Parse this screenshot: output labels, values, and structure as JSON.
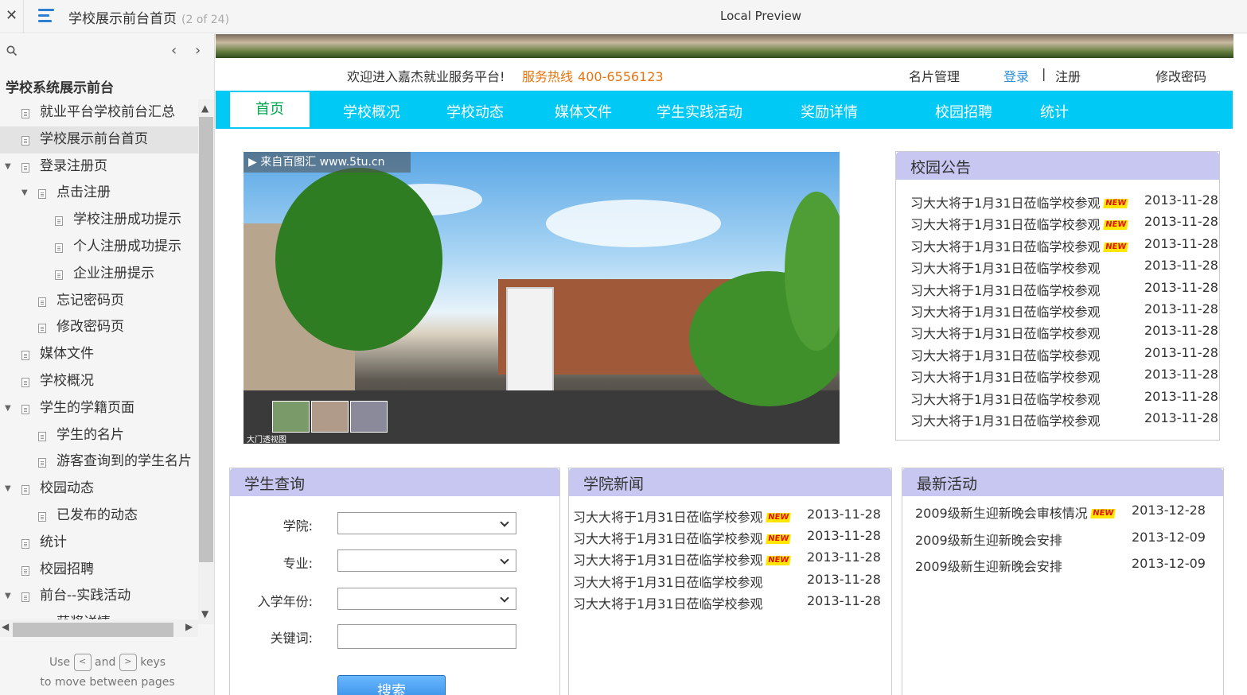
{
  "viewer": {
    "close_label": "✕",
    "page_title": "学校展示前台首页",
    "page_count": "(2 of 24)",
    "preview_title": "Local Preview"
  },
  "sidebar": {
    "search_icon": "search-icon",
    "prev": "‹",
    "next": "›",
    "project_title": "学校系统展示前台",
    "items": [
      {
        "label": "就业平台学校前台汇总",
        "level": 0,
        "toggle": ""
      },
      {
        "label": "学校展示前台首页",
        "level": 0,
        "toggle": "",
        "active": true
      },
      {
        "label": "登录注册页",
        "level": 0,
        "toggle": "▼"
      },
      {
        "label": "点击注册",
        "level": 1,
        "toggle": "▼"
      },
      {
        "label": "学校注册成功提示",
        "level": 2,
        "toggle": ""
      },
      {
        "label": "个人注册成功提示",
        "level": 2,
        "toggle": ""
      },
      {
        "label": "企业注册提示",
        "level": 2,
        "toggle": ""
      },
      {
        "label": "忘记密码页",
        "level": 1,
        "toggle": ""
      },
      {
        "label": "修改密码页",
        "level": 1,
        "toggle": ""
      },
      {
        "label": "媒体文件",
        "level": 0,
        "toggle": ""
      },
      {
        "label": "学校概况",
        "level": 0,
        "toggle": ""
      },
      {
        "label": "学生的学籍页面",
        "level": 0,
        "toggle": "▼"
      },
      {
        "label": "学生的名片",
        "level": 1,
        "toggle": ""
      },
      {
        "label": "游客查询到的学生名片",
        "level": 1,
        "toggle": ""
      },
      {
        "label": "校园动态",
        "level": 0,
        "toggle": "▼"
      },
      {
        "label": "已发布的动态",
        "level": 1,
        "toggle": ""
      },
      {
        "label": "统计",
        "level": 0,
        "toggle": ""
      },
      {
        "label": "校园招聘",
        "level": 0,
        "toggle": ""
      },
      {
        "label": "前台--实践活动",
        "level": 0,
        "toggle": "▼"
      },
      {
        "label": "获奖详情",
        "level": 1,
        "toggle": ""
      }
    ],
    "hint_use": "Use",
    "hint_and": "and",
    "hint_keys": "keys",
    "hint_move": "to move between pages",
    "key_prev": "<",
    "key_next": ">"
  },
  "site": {
    "welcome": "欢迎进入嘉杰就业服务平台!",
    "hotline_label": "服务热线",
    "hotline_number": "400-6556123",
    "card_manage": "名片管理",
    "login": "登录",
    "separator": "|",
    "register": "注册",
    "change_password": "修改密码",
    "nav": [
      "首页",
      "学校概况",
      "学校动态",
      "媒体文件",
      "学生实践活动",
      "奖励详情",
      "校园招聘",
      "统计"
    ],
    "slideshow": {
      "watermark": "▶ 来自百图汇 www.5tu.cn",
      "caption": "大门透视图"
    },
    "announcements": {
      "title": "校园公告",
      "items": [
        {
          "title": "习大大将于1月31日莅临学校参观",
          "date": "2013-11-28",
          "new": true
        },
        {
          "title": "习大大将于1月31日莅临学校参观",
          "date": "2013-11-28",
          "new": true
        },
        {
          "title": "习大大将于1月31日莅临学校参观",
          "date": "2013-11-28",
          "new": true
        },
        {
          "title": "习大大将于1月31日莅临学校参观",
          "date": "2013-11-28",
          "new": false
        },
        {
          "title": "习大大将于1月31日莅临学校参观",
          "date": "2013-11-28",
          "new": false
        },
        {
          "title": "习大大将于1月31日莅临学校参观",
          "date": "2013-11-28",
          "new": false
        },
        {
          "title": "习大大将于1月31日莅临学校参观",
          "date": "2013-11-28",
          "new": false
        },
        {
          "title": "习大大将于1月31日莅临学校参观",
          "date": "2013-11-28",
          "new": false
        },
        {
          "title": "习大大将于1月31日莅临学校参观",
          "date": "2013-11-28",
          "new": false
        },
        {
          "title": "习大大将于1月31日莅临学校参观",
          "date": "2013-11-28",
          "new": false
        },
        {
          "title": "习大大将于1月31日莅临学校参观",
          "date": "2013-11-28",
          "new": false
        }
      ]
    },
    "student_query": {
      "title": "学生查询",
      "college_label": "学院:",
      "major_label": "专业:",
      "year_label": "入学年份:",
      "keyword_label": "关键词:",
      "search_button": "搜索"
    },
    "college_news": {
      "title": "学院新闻",
      "items": [
        {
          "title": "习大大将于1月31日莅临学校参观",
          "date": "2013-11-28",
          "new": true
        },
        {
          "title": "习大大将于1月31日莅临学校参观",
          "date": "2013-11-28",
          "new": true
        },
        {
          "title": "习大大将于1月31日莅临学校参观",
          "date": "2013-11-28",
          "new": true
        },
        {
          "title": "习大大将于1月31日莅临学校参观",
          "date": "2013-11-28",
          "new": false
        },
        {
          "title": "习大大将于1月31日莅临学校参观",
          "date": "2013-11-28",
          "new": false
        }
      ]
    },
    "latest_activities": {
      "title": "最新活动",
      "items": [
        {
          "title": "2009级新生迎新晚会审核情况",
          "date": "2013-12-28",
          "new": true
        },
        {
          "title": "2009级新生迎新晚会安排",
          "date": "2013-12-09",
          "new": false
        },
        {
          "title": "2009级新生迎新晚会安排",
          "date": "2013-12-09",
          "new": false
        }
      ]
    },
    "new_badge": "NEW"
  }
}
